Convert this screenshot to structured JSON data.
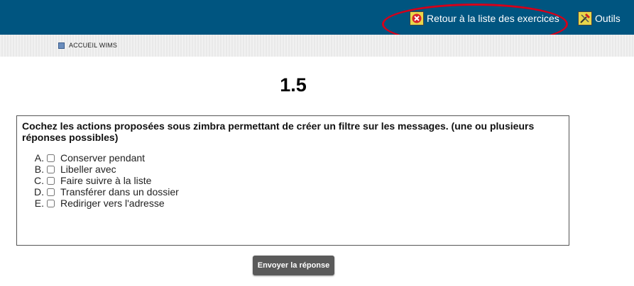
{
  "header": {
    "return_label": "Retour à la liste des exercices",
    "tools_label": "Outils",
    "bar_color": "#005580",
    "highlight_color": "#d4001a"
  },
  "breadcrumb": {
    "home_label": "ACCUEIL WIMS"
  },
  "exercise": {
    "title": "1.5",
    "question": "Cochez les actions proposées sous zimbra permettant de créer un filtre sur les messages. (une ou plusieurs réponses possibles)",
    "choices": [
      {
        "letter": "A.",
        "label": "Conserver pendant",
        "checked": false
      },
      {
        "letter": "B.",
        "label": "Libeller avec",
        "checked": false
      },
      {
        "letter": "C.",
        "label": "Faire suivre à la liste",
        "checked": false
      },
      {
        "letter": "D.",
        "label": "Transférer dans un dossier",
        "checked": false
      },
      {
        "letter": "E.",
        "label": "Rediriger vers l'adresse",
        "checked": false
      }
    ],
    "submit_label": "Envoyer la réponse"
  },
  "icons": {
    "return": "close-icon",
    "tools": "tools-icon",
    "home": "home-icon"
  }
}
